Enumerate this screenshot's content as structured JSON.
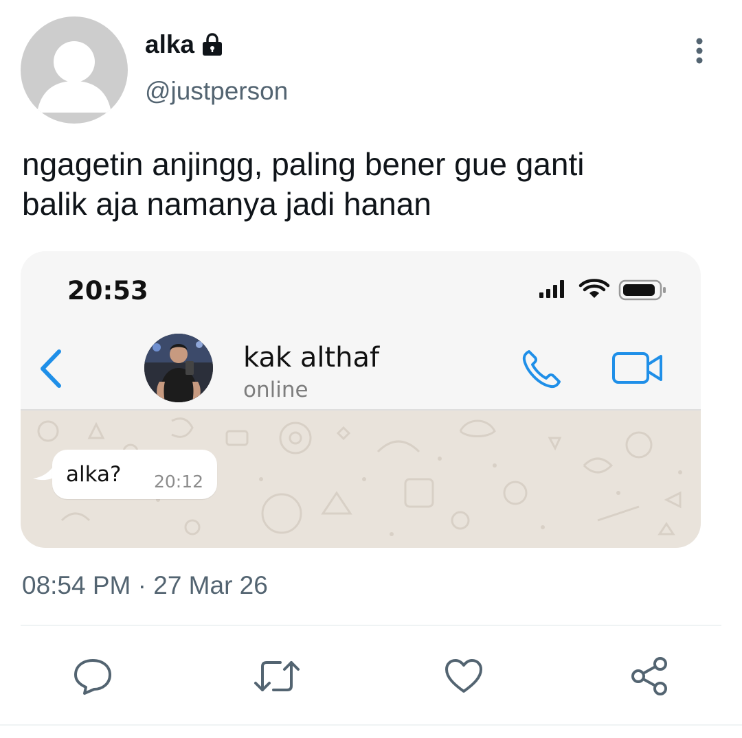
{
  "tweet": {
    "author_name": "alka",
    "handle": "@justperson",
    "text_line1": "ngagetin anjingg, paling bener gue ganti",
    "text_line2": "balik aja namanya jadi hanan",
    "timestamp": "08:54 PM · 27 Mar 26"
  },
  "screenshot": {
    "clock": "20:53",
    "contact_name": "kak althaf",
    "contact_status": "online",
    "message": {
      "text": "alka?",
      "time": "20:12"
    }
  },
  "icons": {
    "lock": "lock-icon",
    "more": "more-vertical-icon",
    "reply": "reply-icon",
    "retweet": "retweet-icon",
    "like": "like-icon",
    "share": "share-icon"
  },
  "colors": {
    "text_primary": "#0f1419",
    "text_secondary": "#536471",
    "ios_blue": "#1f8fe8",
    "chat_background": "#e9e3db"
  }
}
